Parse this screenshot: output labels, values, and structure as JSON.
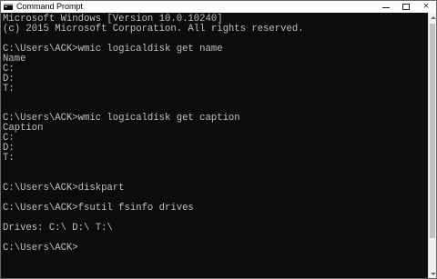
{
  "window": {
    "title": "Command Prompt",
    "icon": "cmd-icon"
  },
  "controls": {
    "minimize": "minimize-icon",
    "maximize": "maximize-icon",
    "close": "×"
  },
  "console": {
    "lines": [
      "Microsoft Windows [Version 10.0.10240]",
      "(c) 2015 Microsoft Corporation. All rights reserved.",
      "",
      "C:\\Users\\ACK>wmic logicaldisk get name",
      "Name",
      "C:",
      "D:",
      "T:",
      "",
      "",
      "C:\\Users\\ACK>wmic logicaldisk get caption",
      "Caption",
      "C:",
      "D:",
      "T:",
      "",
      "",
      "C:\\Users\\ACK>diskpart",
      "",
      "C:\\Users\\ACK>fsutil fsinfo drives",
      "",
      "Drives: C:\\ D:\\ T:\\",
      "",
      "C:\\Users\\ACK>"
    ]
  },
  "colors": {
    "console_bg": "#0c0c0c",
    "console_fg": "#c0c0c0",
    "titlebar_bg": "#ffffff"
  }
}
